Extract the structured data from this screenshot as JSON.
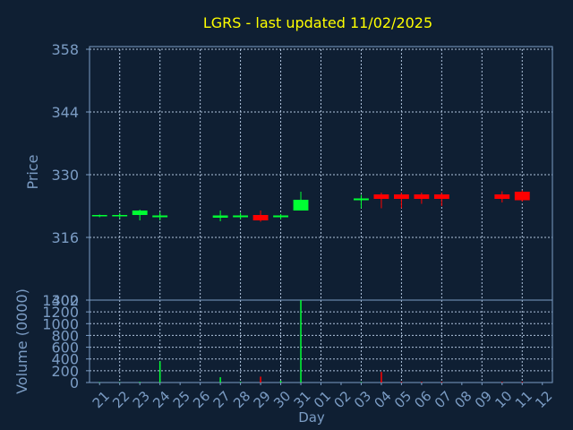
{
  "chart_data": [
    {
      "type": "candlestick",
      "title": "LGRS - last updated 11/02/2025",
      "ylabel": "Price",
      "ylim": [
        302,
        358
      ],
      "yticks": [
        "358",
        "344",
        "330",
        "316",
        "302"
      ],
      "grid": true,
      "x": [
        "21",
        "22",
        "23",
        "24",
        "25",
        "26",
        "27",
        "28",
        "29",
        "30",
        "31",
        "01",
        "02",
        "03",
        "04",
        "05",
        "06",
        "07",
        "08",
        "09",
        "10",
        "11",
        "12"
      ],
      "candles": [
        {
          "day": "21",
          "open": 320.8,
          "high": 321.1,
          "low": 320.5,
          "close": 321.0,
          "color": "#00ff33"
        },
        {
          "day": "22",
          "open": 320.7,
          "high": 321.4,
          "low": 320.2,
          "close": 321.0,
          "color": "#00ff33"
        },
        {
          "day": "23",
          "open": 321.0,
          "high": 322.2,
          "low": 319.8,
          "close": 322.0,
          "color": "#00ff33"
        },
        {
          "day": "24",
          "open": 320.5,
          "high": 321.7,
          "low": 319.8,
          "close": 320.9,
          "color": "#00ff33"
        },
        {
          "day": "27",
          "open": 320.4,
          "high": 322.0,
          "low": 319.6,
          "close": 320.9,
          "color": "#00ff33"
        },
        {
          "day": "28",
          "open": 320.5,
          "high": 321.5,
          "low": 320.0,
          "close": 320.9,
          "color": "#00ff33"
        },
        {
          "day": "29",
          "open": 321.0,
          "high": 322.0,
          "low": 319.5,
          "close": 319.8,
          "color": "#ff0000"
        },
        {
          "day": "30",
          "open": 320.5,
          "high": 321.2,
          "low": 320.0,
          "close": 320.9,
          "color": "#00ff33"
        },
        {
          "day": "31",
          "open": 322.0,
          "high": 326.2,
          "low": 322.0,
          "close": 324.4,
          "color": "#00ff33"
        },
        {
          "day": "03",
          "open": 324.3,
          "high": 325.5,
          "low": 322.5,
          "close": 324.7,
          "color": "#00ff33"
        },
        {
          "day": "04",
          "open": 325.6,
          "high": 326.0,
          "low": 322.5,
          "close": 324.6,
          "color": "#ff0000"
        },
        {
          "day": "05",
          "open": 325.6,
          "high": 326.0,
          "low": 322.5,
          "close": 324.6,
          "color": "#ff0000"
        },
        {
          "day": "06",
          "open": 325.6,
          "high": 326.0,
          "low": 323.5,
          "close": 324.6,
          "color": "#ff0000"
        },
        {
          "day": "07",
          "open": 325.6,
          "high": 326.0,
          "low": 323.0,
          "close": 324.6,
          "color": "#ff0000"
        },
        {
          "day": "10",
          "open": 325.6,
          "high": 326.3,
          "low": 323.8,
          "close": 324.6,
          "color": "#ff0000"
        },
        {
          "day": "11",
          "open": 326.2,
          "high": 326.5,
          "low": 324.0,
          "close": 324.3,
          "color": "#ff0000"
        }
      ]
    },
    {
      "type": "bar",
      "ylabel": "Volume (0000)",
      "xlabel": "Day",
      "ylim": [
        0,
        1400
      ],
      "yticks": [
        "1400",
        "1200",
        "1000",
        "800",
        "600",
        "400",
        "200",
        "0"
      ],
      "grid": true,
      "categories": [
        "21",
        "22",
        "23",
        "24",
        "25",
        "26",
        "27",
        "28",
        "29",
        "30",
        "31",
        "01",
        "02",
        "03",
        "04",
        "05",
        "06",
        "07",
        "08",
        "09",
        "10",
        "11",
        "12"
      ],
      "bars": [
        {
          "day": "21",
          "value": 5,
          "color": "#00ff33"
        },
        {
          "day": "22",
          "value": 5,
          "color": "#00ff33"
        },
        {
          "day": "23",
          "value": 12,
          "color": "#00ff33"
        },
        {
          "day": "24",
          "value": 360,
          "color": "#00ff33"
        },
        {
          "day": "27",
          "value": 90,
          "color": "#00ff33"
        },
        {
          "day": "28",
          "value": 10,
          "color": "#00ff33"
        },
        {
          "day": "29",
          "value": 100,
          "color": "#ff0000"
        },
        {
          "day": "30",
          "value": 30,
          "color": "#00ff33"
        },
        {
          "day": "31",
          "value": 1400,
          "color": "#00ff33"
        },
        {
          "day": "03",
          "value": 8,
          "color": "#00ff33"
        },
        {
          "day": "04",
          "value": 180,
          "color": "#ff0000"
        },
        {
          "day": "05",
          "value": 10,
          "color": "#ff0000"
        },
        {
          "day": "06",
          "value": 10,
          "color": "#ff0000"
        },
        {
          "day": "07",
          "value": 10,
          "color": "#ff0000"
        },
        {
          "day": "10",
          "value": 10,
          "color": "#ff0000"
        },
        {
          "day": "11",
          "value": 10,
          "color": "#ff0000"
        }
      ]
    }
  ],
  "colors": {
    "background": "#0f1f33",
    "axis": "#7b9cc4",
    "grid": "#b0c4de",
    "title": "#ffff00",
    "tick_text": "#7b9cc4"
  }
}
